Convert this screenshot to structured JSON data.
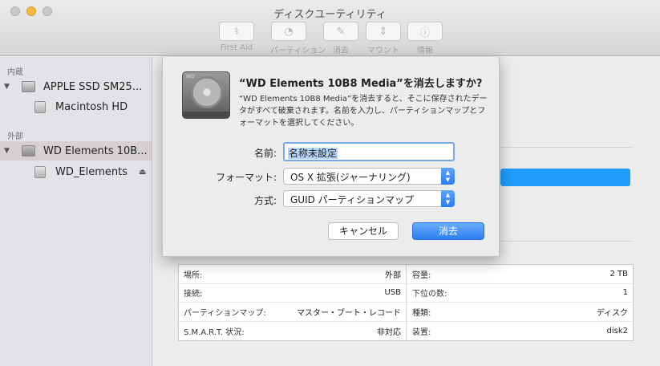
{
  "window": {
    "title": "ディスクユーティリティ"
  },
  "toolbar": [
    {
      "label": "First Aid",
      "icon": "stethoscope-icon",
      "glyph": "⚕"
    },
    {
      "label": "パーティション",
      "icon": "partition-icon",
      "glyph": "◔"
    },
    {
      "label": "消去",
      "icon": "erase-icon",
      "glyph": "✎"
    },
    {
      "label": "マウント",
      "icon": "mount-icon",
      "glyph": "⇕"
    },
    {
      "label": "情報",
      "icon": "info-icon",
      "glyph": "ⓘ"
    }
  ],
  "sidebar": {
    "internal_header": "内蔵",
    "external_header": "外部",
    "internal_disk": "APPLE SSD SM25...",
    "internal_volume": "Macintosh HD",
    "external_disk": "WD Elements 10B...",
    "external_volume": "WD_Elements",
    "disclosure": "▼",
    "eject": "⏏"
  },
  "dialog": {
    "title": "“WD Elements 10B8 Media”を消去しますか?",
    "message": "“WD Elements 10B8 Media”を消去すると、そこに保存されたデータがすべて破棄されます。名前を入力し、パーティションマップとフォーマットを選択してください。",
    "hdd_label": "WD",
    "name_label": "名前:",
    "name_value": "名称未設定",
    "format_label": "フォーマット:",
    "format_value": "OS X 拡張(ジャーナリング)",
    "scheme_label": "方式:",
    "scheme_value": "GUID パーティションマップ",
    "arrows": "▲\n▼",
    "cancel": "キャンセル",
    "erase": "消去"
  },
  "info": {
    "left": [
      {
        "key": "場所:",
        "value": "外部"
      },
      {
        "key": "接続:",
        "value": "USB"
      },
      {
        "key": "パーティションマップ:",
        "value": "マスター・ブート・レコード"
      },
      {
        "key": "S.M.A.R.T. 状況:",
        "value": "非対応"
      }
    ],
    "right": [
      {
        "key": "容量:",
        "value": "2 TB"
      },
      {
        "key": "下位の数:",
        "value": "1"
      },
      {
        "key": "種類:",
        "value": "ディスク"
      },
      {
        "key": "装置:",
        "value": "disk2"
      }
    ]
  },
  "colors": {
    "accent": "#2c7ef4",
    "selection": "#b4d4fb",
    "band": "#1e9dfd"
  }
}
